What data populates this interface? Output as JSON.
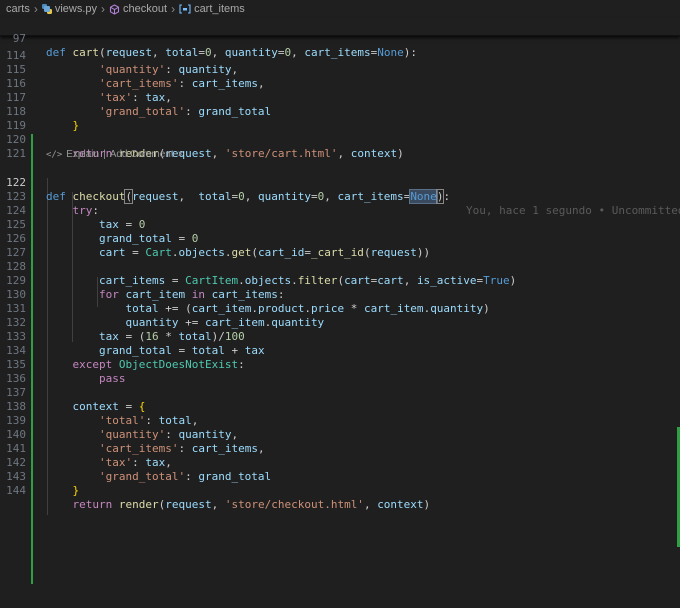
{
  "breadcrumb": {
    "folder": "carts",
    "file": "views.py",
    "function": "checkout",
    "variable": "cart_items"
  },
  "sticky": {
    "line_number": "97"
  },
  "lens": {
    "explain": "Explain",
    "separator": "|",
    "add_comment": "Add Comment",
    "close": "×"
  },
  "blame": "You, hace 1 segundo • Uncommitted",
  "line_numbers": [
    "114",
    "115",
    "116",
    "117",
    "118",
    "119",
    "120",
    "121",
    "122",
    "123",
    "124",
    "125",
    "126",
    "127",
    "128",
    "129",
    "130",
    "131",
    "132",
    "133",
    "134",
    "135",
    "136",
    "137",
    "138",
    "139",
    "140",
    "141",
    "142",
    "143",
    "144"
  ],
  "colors": {
    "added": "#2ea043",
    "background": "#1f1f1f"
  }
}
